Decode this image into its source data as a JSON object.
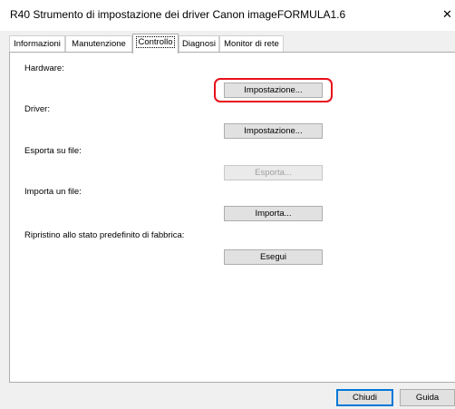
{
  "window": {
    "title": "R40 Strumento di impostazione dei driver Canon imageFORMULA1.6",
    "close_glyph": "✕"
  },
  "tabs": [
    {
      "label": "Informazioni"
    },
    {
      "label": "Manutenzione"
    },
    {
      "label": "Controllo"
    },
    {
      "label": "Diagnosi"
    },
    {
      "label": "Monitor di rete"
    }
  ],
  "control": {
    "hardware_label": "Hardware:",
    "hardware_button": "Impostazione...",
    "driver_label": "Driver:",
    "driver_button": "Impostazione...",
    "export_label": "Esporta su file:",
    "export_button": "Esporta...",
    "import_label": "Importa un file:",
    "import_button": "Importa...",
    "reset_label": "Ripristino allo stato predefinito di fabbrica:",
    "reset_button": "Esegui"
  },
  "footer": {
    "close_button": "Chiudi",
    "help_button": "Guida"
  },
  "colors": {
    "highlight": "#e8101a"
  }
}
